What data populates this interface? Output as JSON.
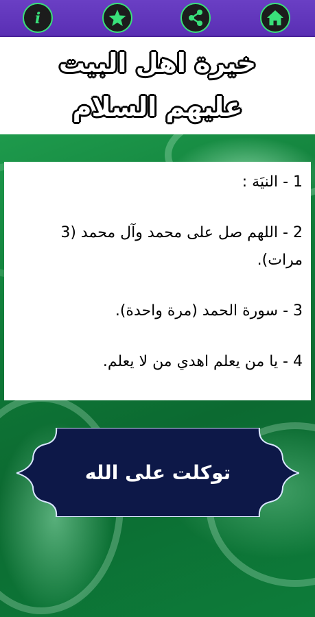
{
  "nav": {
    "buttons": [
      {
        "name": "info",
        "icon": "info-icon"
      },
      {
        "name": "favorite",
        "icon": "star-icon"
      },
      {
        "name": "share",
        "icon": "share-icon"
      },
      {
        "name": "home",
        "icon": "home-icon"
      }
    ]
  },
  "header": {
    "title_line1": "خيرة اهل البيت",
    "title_line2": "عليهم السلام"
  },
  "steps": [
    {
      "text": "1 -  النيَة :"
    },
    {
      "text": "2 -  اللهم صل على محمد وآل محمد (3 مرات)."
    },
    {
      "text": "3 -  سورة الحمد (مرة واحدة)."
    },
    {
      "text": "4 -  يا من يعلم اهدي من لا يعلم."
    }
  ],
  "action": {
    "label": "توكلت على الله"
  },
  "colors": {
    "topbar": "#5a2fb4",
    "icon_accent": "#39e07a",
    "button_bg": "#0d1848",
    "background_green": "#0f7a38"
  }
}
